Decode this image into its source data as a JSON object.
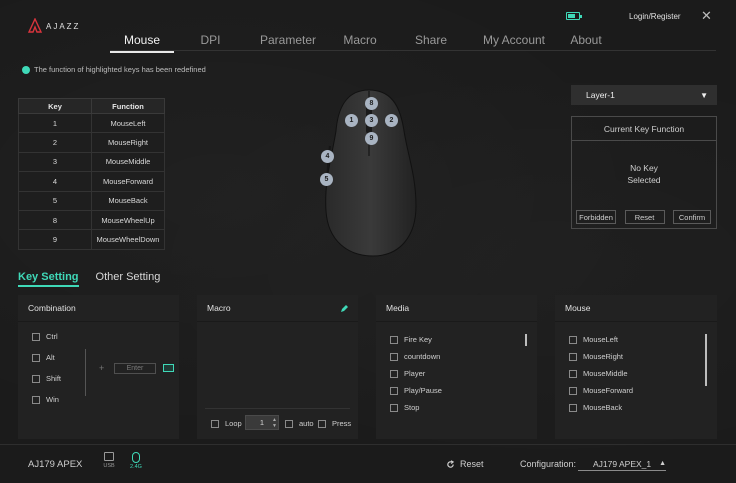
{
  "app": {
    "logo_text": "AJAZZ",
    "login": "Login/Register",
    "close": "✕"
  },
  "nav": [
    "Mouse",
    "DPI",
    "Parameter",
    "Macro",
    "Share",
    "My Account",
    "About"
  ],
  "hint": "The function of highlighted keys has been redefined",
  "key_table": {
    "headers": [
      "Key",
      "Function"
    ],
    "rows": [
      [
        "1",
        "MouseLeft"
      ],
      [
        "2",
        "MouseRight"
      ],
      [
        "3",
        "MouseMiddle"
      ],
      [
        "4",
        "MouseForward"
      ],
      [
        "5",
        "MouseBack"
      ],
      [
        "8",
        "MouseWheelUp"
      ],
      [
        "9",
        "MouseWheelDown"
      ]
    ]
  },
  "mouse_buttons": [
    "8",
    "1",
    "3",
    "2",
    "9",
    "4",
    "5"
  ],
  "layer": "Layer-1",
  "current_key": {
    "title": "Current Key Function",
    "line1": "No Key",
    "line2": "Selected",
    "forbidden": "Forbidden",
    "reset": "Reset",
    "confirm": "Confirm"
  },
  "settings_tabs": [
    "Key Setting",
    "Other Setting"
  ],
  "combination": {
    "title": "Combination",
    "items": [
      "Ctrl",
      "Alt",
      "Shift",
      "Win"
    ],
    "plus": "+",
    "input_placeholder": "Enter"
  },
  "macro": {
    "title": "Macro",
    "loop": "Loop",
    "loop_value": "1",
    "auto": "auto",
    "press": "Press"
  },
  "media": {
    "title": "Media",
    "items": [
      "Fire Key",
      "countdown",
      "Player",
      "Play/Pause",
      "Stop"
    ]
  },
  "mouse_panel": {
    "title": "Mouse",
    "items": [
      "MouseLeft",
      "MouseRight",
      "MouseMiddle",
      "MouseForward",
      "MouseBack"
    ]
  },
  "bottom": {
    "device": "AJ179 APEX",
    "usb": "USB",
    "wireless": "2.4G",
    "reset": "Reset",
    "config_label": "Configuration:",
    "config_value": "AJ179 APEX_1"
  },
  "battery_level": 0.7,
  "colors": {
    "accent": "#3fd9b8",
    "background": "#1b1b1b",
    "panel": "#222222"
  }
}
